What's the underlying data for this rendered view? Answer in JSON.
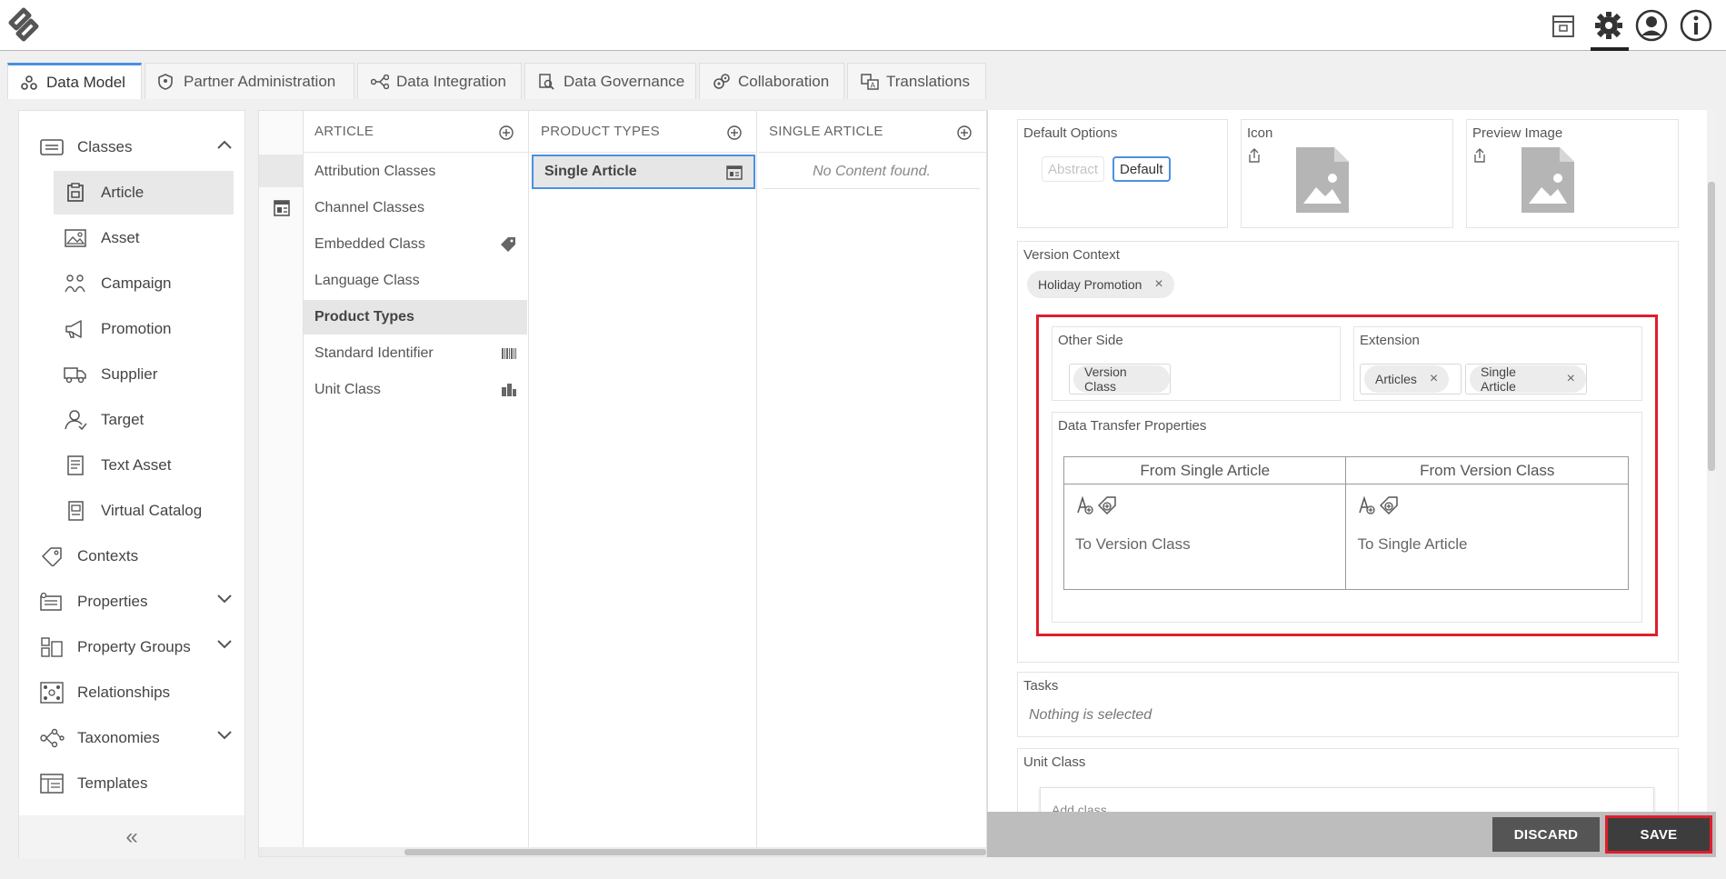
{
  "tabs": [
    {
      "label": "Data Model",
      "icon": "data-model-icon",
      "active": true
    },
    {
      "label": "Partner Administration",
      "icon": "shield-icon"
    },
    {
      "label": "Data Integration",
      "icon": "integration-icon"
    },
    {
      "label": "Data Governance",
      "icon": "governance-icon"
    },
    {
      "label": "Collaboration",
      "icon": "collaboration-icon"
    },
    {
      "label": "Translations",
      "icon": "translate-icon"
    }
  ],
  "nav": {
    "classes": {
      "label": "Classes",
      "expanded": true
    },
    "sub": [
      {
        "label": "Article",
        "icon": "article-icon",
        "selected": true
      },
      {
        "label": "Asset",
        "icon": "image-icon"
      },
      {
        "label": "Campaign",
        "icon": "campaign-icon"
      },
      {
        "label": "Promotion",
        "icon": "megaphone-icon"
      },
      {
        "label": "Supplier",
        "icon": "truck-icon"
      },
      {
        "label": "Target",
        "icon": "target-user-icon"
      },
      {
        "label": "Text Asset",
        "icon": "text-document-icon"
      },
      {
        "label": "Virtual Catalog",
        "icon": "catalog-icon"
      }
    ],
    "top": [
      {
        "label": "Contexts",
        "icon": "tag-icon"
      },
      {
        "label": "Properties",
        "icon": "properties-icon",
        "expandable": true
      },
      {
        "label": "Property Groups",
        "icon": "property-groups-icon",
        "expandable": true
      },
      {
        "label": "Relationships",
        "icon": "relationships-icon"
      },
      {
        "label": "Taxonomies",
        "icon": "taxonomies-icon",
        "expandable": true
      },
      {
        "label": "Templates",
        "icon": "templates-icon"
      }
    ],
    "collapse_label": "«"
  },
  "browser": {
    "article": {
      "header": "ARTICLE",
      "items": [
        "Attribution Classes",
        "Channel Classes",
        "Embedded Class",
        "Language Class",
        "Product Types",
        "Standard Identifier",
        "Unit Class"
      ],
      "selected": "Product Types"
    },
    "product_types": {
      "header": "PRODUCT TYPES",
      "items": [
        "Single Article"
      ],
      "selected": "Single Article"
    },
    "single_article": {
      "header": "SINGLE ARTICLE",
      "empty_text": "No Content found."
    }
  },
  "detail": {
    "default_options": {
      "label": "Default Options",
      "options": [
        "Abstract",
        "Default"
      ],
      "selected": "Default"
    },
    "icon": {
      "label": "Icon"
    },
    "preview_image": {
      "label": "Preview Image"
    },
    "version_context": {
      "label": "Version Context",
      "chip": "Holiday Promotion"
    },
    "other_side": {
      "label": "Other Side",
      "value": "Version Class"
    },
    "extension": {
      "label": "Extension",
      "chips": [
        "Articles",
        "Single Article"
      ]
    },
    "dtp": {
      "label": "Data Transfer Properties",
      "col1_header": "From Single Article",
      "col2_header": "From Version Class",
      "col1_text": "To Version Class",
      "col2_text": "To Single Article"
    },
    "tasks": {
      "label": "Tasks",
      "empty": "Nothing is selected"
    },
    "unit_class": {
      "label": "Unit Class",
      "add_placeholder": "Add class"
    }
  },
  "footer": {
    "discard": "DISCARD",
    "save": "SAVE"
  },
  "colors": {
    "accent_blue": "#4a90e2",
    "highlight_red": "#e01e2c",
    "discard_bg": "#555555",
    "save_bg": "#3d3d3d"
  }
}
